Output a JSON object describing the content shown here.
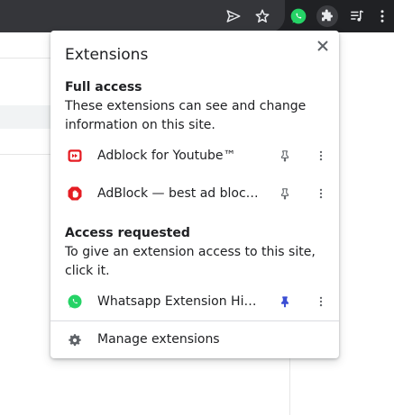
{
  "toolbar": {
    "icons": [
      "send-icon",
      "star-icon",
      "whatsapp-icon",
      "extensions-puzzle-icon",
      "media-queue-icon",
      "more-vertical-icon"
    ]
  },
  "popup": {
    "title": "Extensions",
    "full_access": {
      "heading": "Full access",
      "description": "These extensions can see and change information on this site.",
      "items": [
        {
          "name": "Adblock for Youtube™",
          "icon": "adblock-youtube-icon",
          "pinned": false
        },
        {
          "name": "AdBlock — best ad blocker",
          "icon": "adblock-icon",
          "pinned": false
        }
      ]
    },
    "access_requested": {
      "heading": "Access requested",
      "description": "To give an extension access to this site, click it.",
      "items": [
        {
          "name": "Whatsapp Extension Highlights",
          "icon": "whatsapp-icon",
          "pinned": true
        }
      ]
    },
    "manage_label": "Manage extensions"
  },
  "colors": {
    "toolbar_bg": "#202124",
    "pin_active": "#3c4fd4",
    "whatsapp_green": "#25d366",
    "adblock_red": "#e51c23"
  }
}
